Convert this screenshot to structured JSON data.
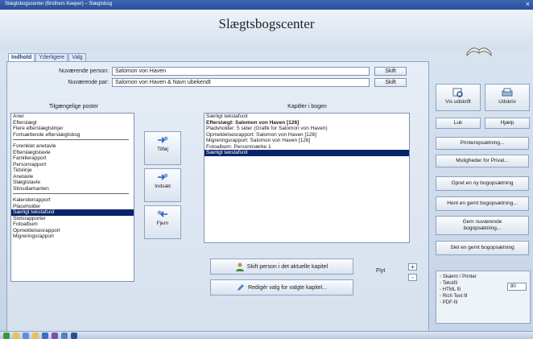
{
  "window": {
    "title": "Slægtsbogscenter (Brothers Keeper) – Slægtsbog",
    "close_glyph": "×"
  },
  "app_title": "Slægtsbogscenter",
  "tabs": [
    {
      "label": "Indhold"
    },
    {
      "label": "Yderligere"
    },
    {
      "label": "Valg"
    }
  ],
  "current": {
    "person_label": "Nuværende person:",
    "person_value": "Salomon von Haven",
    "pair_label": "Nuværende par:",
    "pair_value": "Salomon von Haven & Navn ubekendt",
    "skift1": "Skift",
    "skift2": "Skift"
  },
  "available": {
    "header": "Tilgængelige poster",
    "items": [
      "Aner",
      "Efterslægt",
      "Flere efterslægtslinjer",
      "Fortsættende efterslægtsbog",
      "Forenklet anetavle",
      "Efterslægtstavle",
      "Familierapport",
      "Personrapport",
      "Tidslinje",
      "Anetavle",
      "Slægtstavle",
      "Stinsdiamanten",
      "Kalenderrapport",
      "Placeholder",
      "Særligt tekstafsnit",
      "Slotsrapporter",
      "Fotoalbum",
      "Opmeldelsesrapport",
      "Migreringsrapport"
    ]
  },
  "chapters": {
    "header": "Kapitler i bogen",
    "items": [
      "Særligt tekstafsnit",
      "Efterslægt: Salomon von Haven [126]",
      "Pladsholder: 5 sider (Grafik for Salomon von Haven)",
      "Opmeldelsesrapport: Salomon von Haven [126]",
      "Migreringsrapport: Salomon von Haven [126]",
      "Fotoalbum: Personmærke 1",
      "Særligt tekstafsnit"
    ]
  },
  "mid_buttons": {
    "add": "Tilføj",
    "insert": "Indsæt",
    "remove": "Fjern"
  },
  "bottom_buttons": {
    "change_person": "Skift person i det aktuelle kapitel",
    "edit_options": "Redigér valg for valgte kapitel..."
  },
  "move": {
    "label": "Flyt",
    "plus": "+",
    "minus": "-"
  },
  "right_panel": {
    "show_book": "Vis udskrift",
    "print": "Udskriv",
    "close": "Luk",
    "help": "Hjælp",
    "printer_setup": "Printeropsætning...",
    "private_options": "Muligheder for Privat...",
    "new_setup": "Opret en ny bogopsætning",
    "load_setup": "Hent en gemt bogopsætning...",
    "save_current": "Gem nuværende bogopsætning...",
    "delete_setup": "Slet en gemt bogopsætning",
    "outputs": [
      "Skærm / Printer",
      "Tekstfil",
      "HTML fil",
      "Rich Text fil",
      "PDF-fil"
    ],
    "width_value": "80"
  }
}
